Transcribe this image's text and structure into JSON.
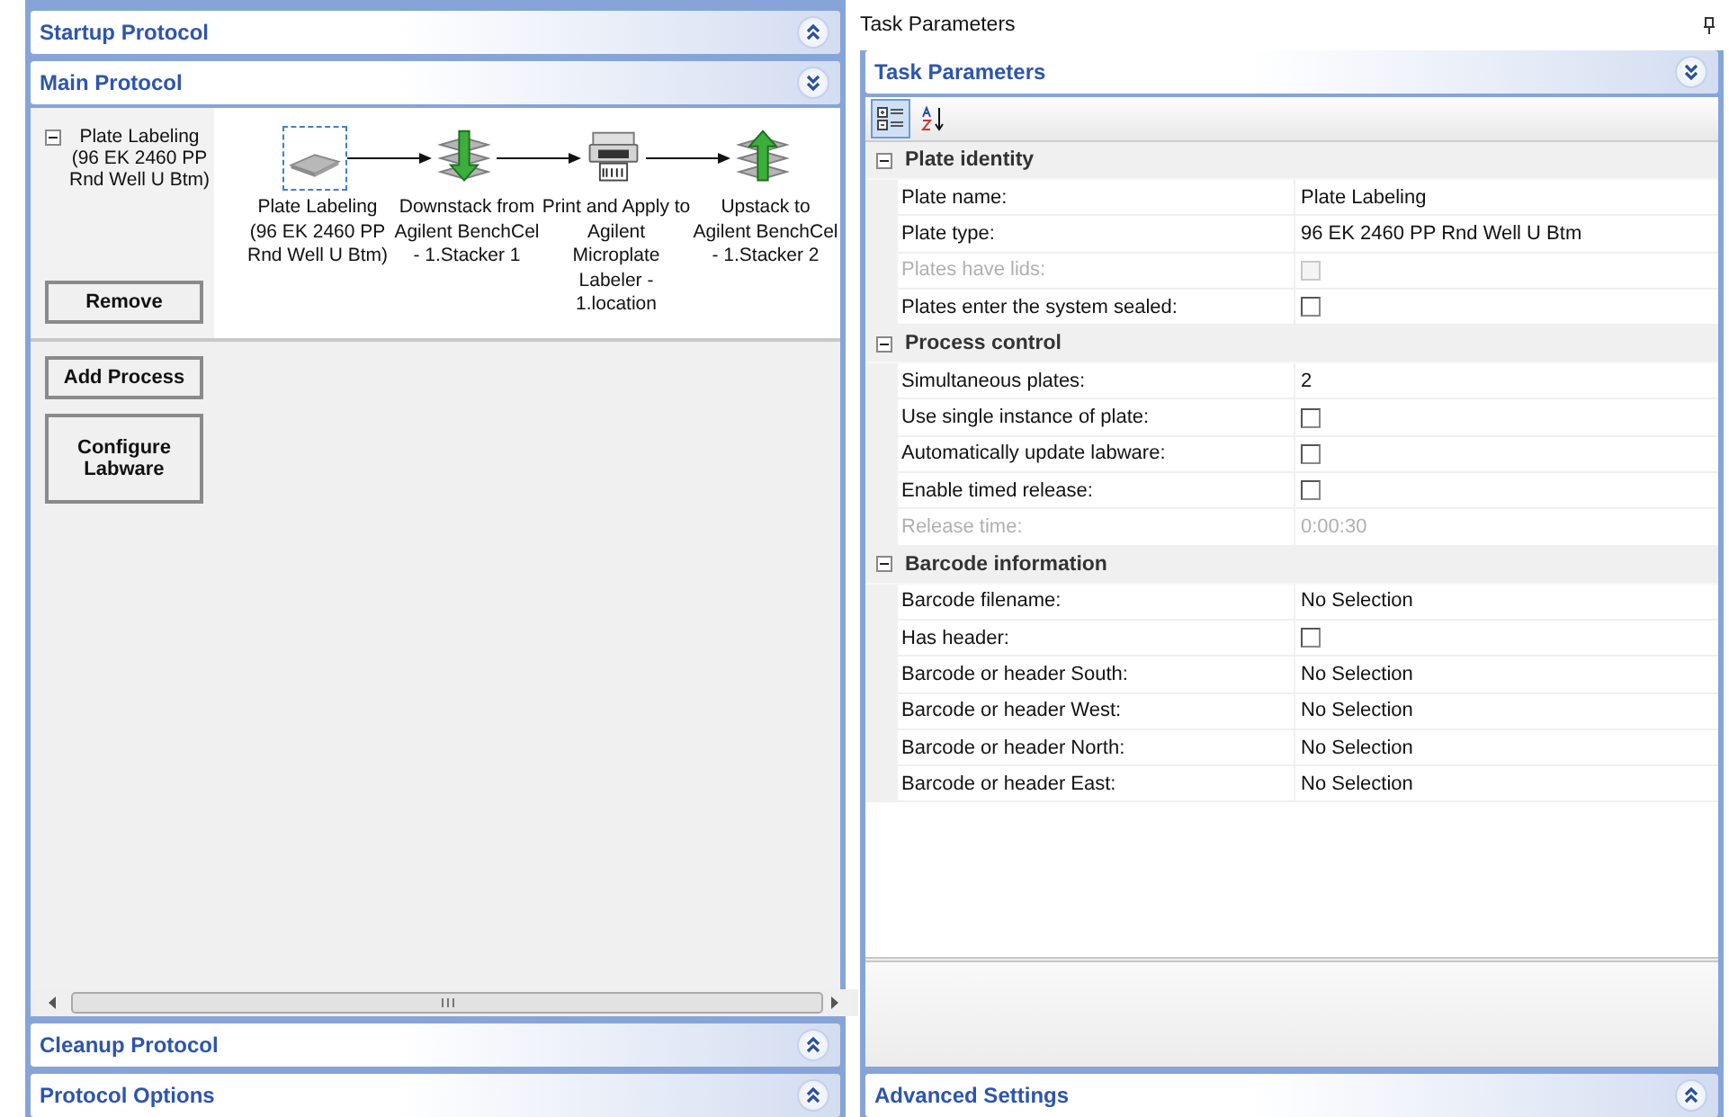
{
  "left_panel": {
    "sections_top": [
      {
        "title": "Startup Protocol",
        "expanded": false
      },
      {
        "title": "Main Protocol",
        "expanded": true
      }
    ],
    "tree": {
      "label": "Plate Labeling (96 EK 2460 PP  Rnd Well U Btm)",
      "expanded": true
    },
    "remove_button": "Remove",
    "workflow": [
      {
        "kind": "plate",
        "label": "Plate Labeling (96 EK 2460 PP Rnd Well U Btm)",
        "selected": true
      },
      {
        "kind": "downstack",
        "label": "Downstack from Agilent BenchCel - 1.Stacker 1",
        "selected": false
      },
      {
        "kind": "printer",
        "label": "Print and Apply to Agilent Microplate Labeler - 1.location",
        "selected": false
      },
      {
        "kind": "upstack",
        "label": "Upstack to Agilent BenchCel - 1.Stacker 2",
        "selected": false
      }
    ],
    "buttons": [
      "Add Process",
      "Configure Labware"
    ],
    "sections_bottom": [
      {
        "title": "Cleanup Protocol",
        "expanded": false
      },
      {
        "title": "Protocol Options",
        "expanded": false
      }
    ]
  },
  "right_panel": {
    "title": "Task Parameters",
    "header": {
      "title": "Task Parameters",
      "expanded": true
    },
    "toolbar": [
      {
        "kind": "categorized",
        "selected": true
      },
      {
        "kind": "alphabetical",
        "selected": false
      }
    ],
    "categories": [
      {
        "name": "Plate identity",
        "expanded": true,
        "rows": [
          {
            "label": "Plate name:",
            "kind": "text",
            "value": "Plate Labeling",
            "disabled": false
          },
          {
            "label": "Plate type:",
            "kind": "text",
            "value": "96 EK 2460 PP  Rnd Well U Btm",
            "disabled": false
          },
          {
            "label": "Plates have lids:",
            "kind": "checkbox",
            "checked": false,
            "disabled": true
          },
          {
            "label": "Plates enter the system sealed:",
            "kind": "checkbox",
            "checked": false,
            "disabled": false
          }
        ]
      },
      {
        "name": "Process control",
        "expanded": true,
        "rows": [
          {
            "label": "Simultaneous plates:",
            "kind": "text",
            "value": "2",
            "disabled": false
          },
          {
            "label": "Use single instance of plate:",
            "kind": "checkbox",
            "checked": false,
            "disabled": false
          },
          {
            "label": "Automatically update labware:",
            "kind": "checkbox",
            "checked": false,
            "disabled": false
          },
          {
            "label": "Enable timed release:",
            "kind": "checkbox",
            "checked": false,
            "disabled": false
          },
          {
            "label": "Release time:",
            "kind": "text",
            "value": "0:00:30",
            "disabled": true
          }
        ]
      },
      {
        "name": "Barcode information",
        "expanded": true,
        "rows": [
          {
            "label": "Barcode filename:",
            "kind": "text",
            "value": "No Selection",
            "disabled": false
          },
          {
            "label": "Has header:",
            "kind": "checkbox",
            "checked": false,
            "disabled": false
          },
          {
            "label": "Barcode or header South:",
            "kind": "text",
            "value": "No Selection",
            "disabled": false
          },
          {
            "label": "Barcode or header West:",
            "kind": "text",
            "value": "No Selection",
            "disabled": false
          },
          {
            "label": "Barcode or header North:",
            "kind": "text",
            "value": "No Selection",
            "disabled": false
          },
          {
            "label": "Barcode or header East:",
            "kind": "text",
            "value": "No Selection",
            "disabled": false
          }
        ]
      }
    ],
    "footer": {
      "title": "Advanced Settings",
      "expanded": false
    }
  }
}
